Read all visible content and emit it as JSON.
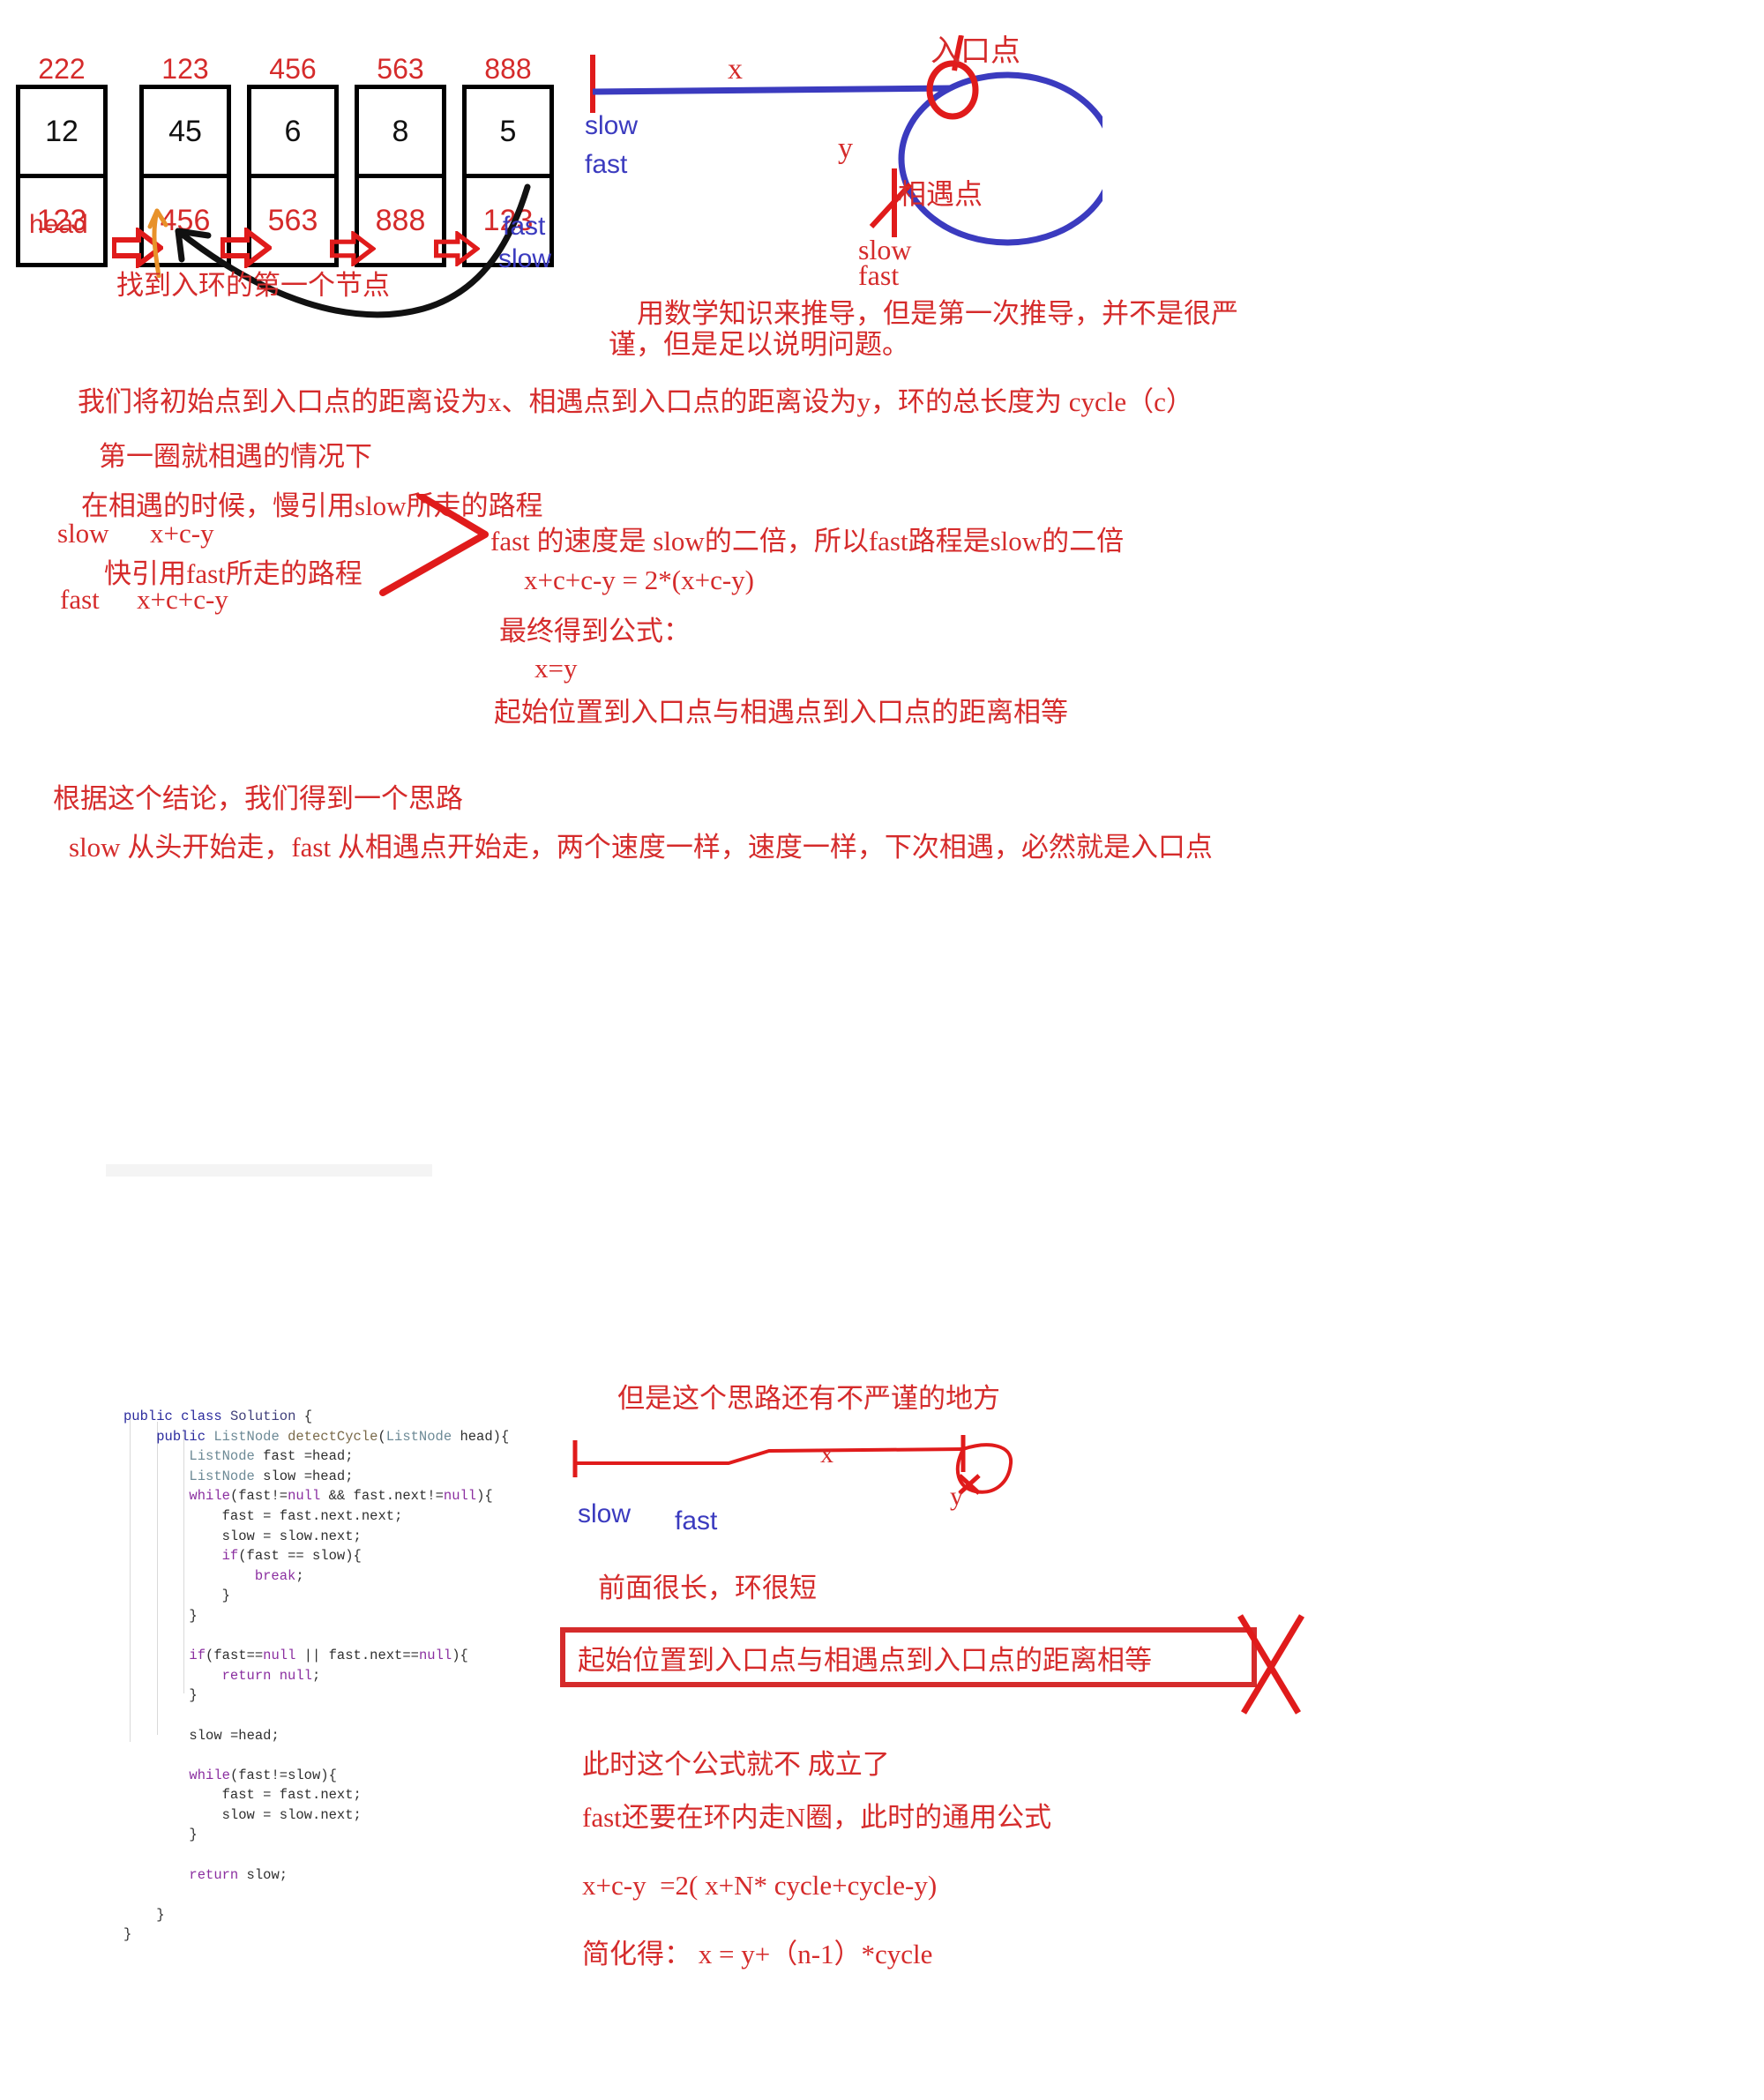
{
  "linked_list": {
    "nodes": [
      {
        "address": "222",
        "value": "12",
        "next": "123"
      },
      {
        "address": "123",
        "value": "45",
        "next": "456"
      },
      {
        "address": "456",
        "value": "6",
        "next": "563"
      },
      {
        "address": "563",
        "value": "8",
        "next": "888"
      },
      {
        "address": "888",
        "value": "5",
        "next": "123"
      }
    ],
    "head_label": "head",
    "cycle_entry_note": "找到入环的第一个节点",
    "tail_pointer_labels": [
      "fast",
      "slow"
    ]
  },
  "cycle_diagram": {
    "entry_label": "入口点",
    "meet_label": "相遇点",
    "x_label": "x",
    "y_label": "y",
    "start_pointers": [
      "slow",
      "fast"
    ],
    "meet_pointers": [
      "slow",
      "fast"
    ],
    "note_line1": "用数学知识来推导，但是第一次推导，并不是很严",
    "note_line2": "谨，但是足以说明问题。"
  },
  "derivation": {
    "definition": "我们将初始点到入口点的距离设为x、相遇点到入口点的距离设为y，环的总长度为 cycle（c）",
    "case_title": "第一圈就相遇的情况下",
    "slow_sentence": "在相遇的时候，慢引用slow所走的路程",
    "slow_name": "slow",
    "slow_formula": "x+c-y",
    "fast_sentence": "快引用fast所走的路程",
    "fast_name": "fast",
    "fast_formula": "x+c+c-y",
    "speed_note": "fast 的速度是 slow的二倍，所以fast路程是slow的二倍",
    "equation": "x+c+c-y = 2*(x+c-y)",
    "final_label": "最终得到公式：",
    "final_formula": "x=y",
    "conclusion": "起始位置到入口点与相遇点到入口点的距离相等"
  },
  "idea": {
    "heading": "根据这个结论，我们得到一个思路",
    "body": "slow 从头开始走，fast 从相遇点开始走，两个速度一样，速度一样，下次相遇，必然就是入口点"
  },
  "code": {
    "lines": [
      "public class Solution {",
      "    public ListNode detectCycle(ListNode head){",
      "        ListNode fast =head;",
      "        ListNode slow =head;",
      "        while(fast!=null && fast.next!=null){",
      "            fast = fast.next.next;",
      "            slow = slow.next;",
      "            if(fast == slow){",
      "                break;",
      "            }",
      "        }",
      "",
      "        if(fast==null || fast.next==null){",
      "            return null;",
      "        }",
      "",
      "        slow =head;",
      "",
      "        while(fast!=slow){",
      "            fast = fast.next;",
      "            slow = slow.next;",
      "        }",
      "",
      "        return slow;",
      "",
      "    }",
      "}"
    ]
  },
  "caveat": {
    "heading": "但是这个思路还有不严谨的地方",
    "diagram": {
      "x_label": "x",
      "y_label": "y",
      "slow_label": "slow",
      "fast_label": "fast"
    },
    "shape_note": "前面很长，环很短",
    "crossed_statement": "起始位置到入口点与相遇点到入口点的距离相等",
    "invalid_note": "此时这个公式就不 成立了",
    "general_note": "fast还要在环内走N圈，此时的通用公式",
    "general_formula": "x+c-y  =2( x+N* cycle+cycle-y)",
    "simplified": "简化得： x = y+（n-1）*cycle"
  },
  "colors": {
    "red": "#d52b2b",
    "blue": "#3b3bbf",
    "black": "#000000",
    "orange": "#e8922a"
  }
}
